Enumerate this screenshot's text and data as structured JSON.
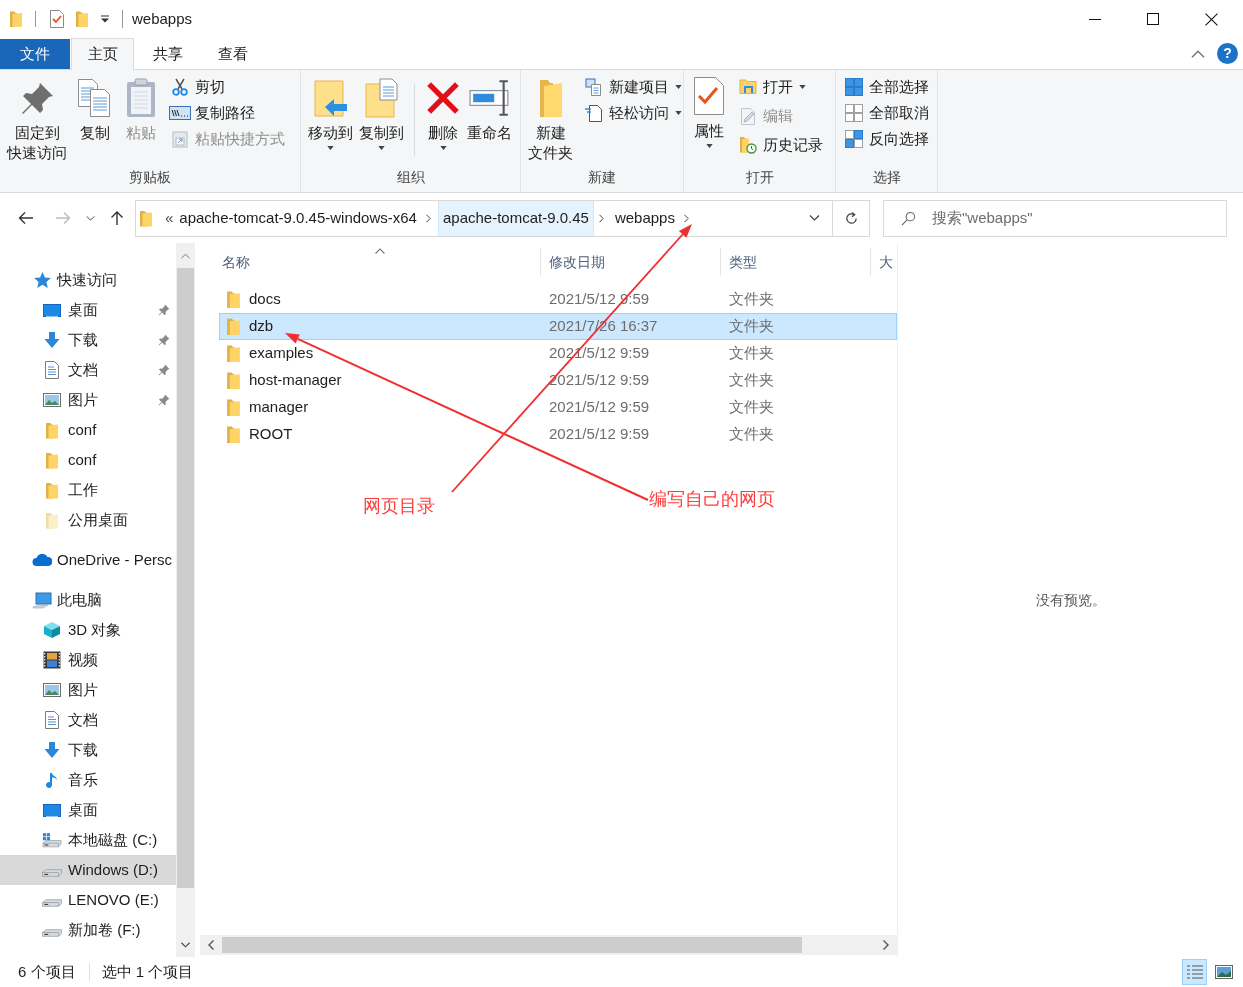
{
  "title_bar": {
    "title": "webapps"
  },
  "ribbon_tabs": [
    {
      "label": "文件",
      "kind": "file",
      "selected": false
    },
    {
      "label": "主页",
      "kind": "tab",
      "selected": true
    },
    {
      "label": "共享",
      "kind": "tab",
      "selected": false
    },
    {
      "label": "查看",
      "kind": "tab",
      "selected": false
    }
  ],
  "help": {
    "label": "?"
  },
  "ribbon_groups": [
    {
      "label": "剪贴板",
      "items": [
        {
          "kind": "large",
          "lines": [
            "固定到",
            "快速访问"
          ],
          "disabled": false,
          "dropdown": false
        },
        {
          "kind": "large",
          "lines": [
            "复制"
          ],
          "disabled": false,
          "dropdown": false
        },
        {
          "kind": "large",
          "lines": [
            "粘贴"
          ],
          "disabled": true,
          "dropdown": false
        },
        {
          "kind": "small",
          "label": "剪切",
          "disabled": false,
          "dropdown": false
        },
        {
          "kind": "small",
          "label": "复制路径",
          "disabled": false,
          "dropdown": false
        },
        {
          "kind": "small",
          "label": "粘贴快捷方式",
          "disabled": true,
          "dropdown": false
        }
      ]
    },
    {
      "label": "组织",
      "items": [
        {
          "kind": "large",
          "lines": [
            "移动到"
          ],
          "disabled": false,
          "dropdown": true
        },
        {
          "kind": "large",
          "lines": [
            "复制到"
          ],
          "disabled": false,
          "dropdown": true
        },
        {
          "kind": "separator"
        },
        {
          "kind": "large",
          "lines": [
            "删除"
          ],
          "disabled": false,
          "dropdown": true
        },
        {
          "kind": "large",
          "lines": [
            "重命名"
          ],
          "disabled": false,
          "dropdown": false
        }
      ]
    },
    {
      "label": "新建",
      "items": [
        {
          "kind": "large",
          "lines": [
            "新建",
            "文件夹"
          ],
          "disabled": false,
          "dropdown": false
        },
        {
          "kind": "small",
          "label": "新建项目",
          "disabled": false,
          "dropdown": true
        },
        {
          "kind": "small",
          "label": "轻松访问",
          "disabled": false,
          "dropdown": true
        }
      ]
    },
    {
      "label": "打开",
      "items": [
        {
          "kind": "large",
          "lines": [
            "属性"
          ],
          "disabled": false,
          "dropdown": true
        },
        {
          "kind": "small",
          "label": "打开",
          "disabled": false,
          "dropdown": true
        },
        {
          "kind": "small",
          "label": "编辑",
          "disabled": true,
          "dropdown": false
        },
        {
          "kind": "small",
          "label": "历史记录",
          "disabled": false,
          "dropdown": false
        }
      ]
    },
    {
      "label": "选择",
      "items": [
        {
          "kind": "small",
          "label": "全部选择",
          "disabled": false,
          "dropdown": false
        },
        {
          "kind": "small",
          "label": "全部取消",
          "disabled": false,
          "dropdown": false
        },
        {
          "kind": "small",
          "label": "反向选择",
          "disabled": false,
          "dropdown": false
        }
      ]
    }
  ],
  "navigation": {
    "back_disabled": false,
    "forward_disabled": true
  },
  "address_bar": {
    "overflow_mark": "«",
    "crumbs": [
      {
        "label": "apache-tomcat-9.0.45-windows-x64",
        "highlighted": false
      },
      {
        "label": "apache-tomcat-9.0.45",
        "highlighted": true
      },
      {
        "label": "webapps",
        "highlighted": false
      }
    ]
  },
  "search": {
    "placeholder": "搜索\"webapps\""
  },
  "sidebar": {
    "items": [
      {
        "label": "快速访问",
        "selected": false,
        "children": [
          {
            "label": "桌面",
            "pinned": true,
            "selected": false
          },
          {
            "label": "下载",
            "pinned": true,
            "selected": false
          },
          {
            "label": "文档",
            "pinned": true,
            "selected": false
          },
          {
            "label": "图片",
            "pinned": true,
            "selected": false
          },
          {
            "label": "conf",
            "pinned": false,
            "selected": false
          },
          {
            "label": "conf",
            "pinned": false,
            "selected": false
          },
          {
            "label": "工作",
            "pinned": false,
            "selected": false
          },
          {
            "label": "公用桌面",
            "pinned": false,
            "selected": false
          }
        ]
      },
      {
        "label": "OneDrive - Persc",
        "selected": false
      },
      {
        "label": "此电脑",
        "selected": false,
        "children": [
          {
            "label": "3D 对象",
            "selected": false
          },
          {
            "label": "视频",
            "selected": false
          },
          {
            "label": "图片",
            "selected": false
          },
          {
            "label": "文档",
            "selected": false
          },
          {
            "label": "下载",
            "selected": false
          },
          {
            "label": "音乐",
            "selected": false
          },
          {
            "label": "桌面",
            "selected": false
          },
          {
            "label": "本地磁盘 (C:)",
            "selected": false
          },
          {
            "label": "Windows (D:)",
            "selected": true
          },
          {
            "label": "LENOVO (E:)",
            "selected": false
          },
          {
            "label": "新加卷 (F:)",
            "selected": false
          }
        ]
      }
    ]
  },
  "file_list": {
    "columns": [
      {
        "label": "名称",
        "sorted": true
      },
      {
        "label": "修改日期",
        "sorted": false
      },
      {
        "label": "类型",
        "sorted": false
      },
      {
        "label": "大",
        "sorted": false
      }
    ],
    "rows": [
      {
        "name": "docs",
        "modified": "2021/5/12 9:59",
        "type": "文件夹",
        "selected": false
      },
      {
        "name": "dzb",
        "modified": "2021/7/26 16:37",
        "type": "文件夹",
        "selected": true
      },
      {
        "name": "examples",
        "modified": "2021/5/12 9:59",
        "type": "文件夹",
        "selected": false
      },
      {
        "name": "host-manager",
        "modified": "2021/5/12 9:59",
        "type": "文件夹",
        "selected": false
      },
      {
        "name": "manager",
        "modified": "2021/5/12 9:59",
        "type": "文件夹",
        "selected": false
      },
      {
        "name": "ROOT",
        "modified": "2021/5/12 9:59",
        "type": "文件夹",
        "selected": false
      }
    ]
  },
  "annotations": [
    {
      "label": "网页目录"
    },
    {
      "label": "编写自己的网页"
    }
  ],
  "preview": {
    "message": "没有预览。"
  },
  "status_bar": {
    "item_count": "6 个项目",
    "selection": "选中 1 个项目",
    "view_modes": [
      {
        "selected": true
      },
      {
        "selected": false
      }
    ]
  }
}
